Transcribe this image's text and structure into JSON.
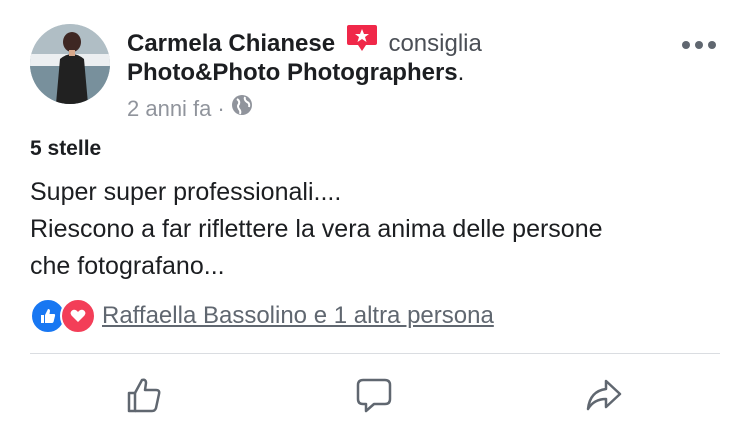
{
  "post": {
    "author": "Carmela Chianese",
    "verb": "consiglia",
    "page": "Photo&Photo Photographers",
    "page_suffix": ".",
    "time": "2 anni fa",
    "separator": "·",
    "rating": "5 stelle",
    "text_lines": [
      "Super super professionali....",
      "Riescono a far riflettere la vera anima delle persone",
      "che fotografano..."
    ],
    "reactions_text": "Raffaella Bassolino e 1 altra persona"
  },
  "icons": {
    "recommend": "recommend-star-icon",
    "privacy": "globe-icon",
    "more": "more-options-icon",
    "like_reaction": "like-reaction-icon",
    "love_reaction": "love-reaction-icon",
    "like_action": "thumbs-up-icon",
    "comment_action": "comment-icon",
    "share_action": "share-icon"
  },
  "colors": {
    "recommend": "#f02849",
    "like": "#1877f2",
    "love": "#f33e58",
    "icon_gray": "#606770"
  }
}
